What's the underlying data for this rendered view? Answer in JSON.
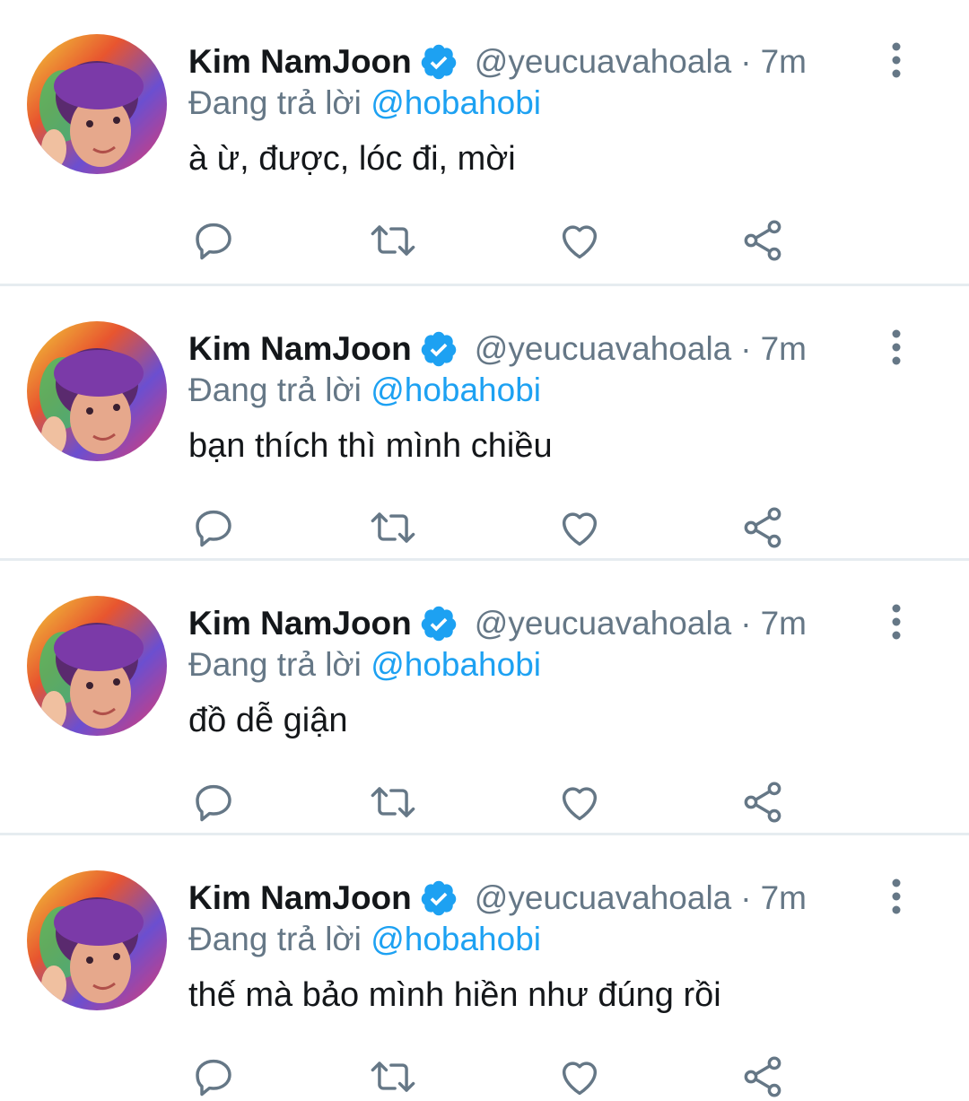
{
  "colors": {
    "name": "#14171a",
    "secondary": "#657786",
    "mention": "#1da1f2",
    "verified": "#1da1f2",
    "divider": "#e6ecf0"
  },
  "tweets": [
    {
      "name": "Kim NamJoon",
      "handle": "@yeucuavahoala",
      "separator": "·",
      "time": "7m",
      "reply_prefix": "Đang trả lời",
      "reply_to": "@hobahobi",
      "text": "à ừ, được, lóc đi, mời",
      "icons": [
        "verified-badge-icon",
        "more-vertical-icon",
        "reply-icon",
        "retweet-icon",
        "like-icon",
        "share-icon"
      ]
    },
    {
      "name": "Kim NamJoon",
      "handle": "@yeucuavahoala",
      "separator": "·",
      "time": "7m",
      "reply_prefix": "Đang trả lời",
      "reply_to": "@hobahobi",
      "text": "bạn thích thì mình chiều",
      "icons": [
        "verified-badge-icon",
        "more-vertical-icon",
        "reply-icon",
        "retweet-icon",
        "like-icon",
        "share-icon"
      ]
    },
    {
      "name": "Kim NamJoon",
      "handle": "@yeucuavahoala",
      "separator": "·",
      "time": "7m",
      "reply_prefix": "Đang trả lời",
      "reply_to": "@hobahobi",
      "text": "đồ dễ giận",
      "icons": [
        "verified-badge-icon",
        "more-vertical-icon",
        "reply-icon",
        "retweet-icon",
        "like-icon",
        "share-icon"
      ]
    },
    {
      "name": "Kim NamJoon",
      "handle": "@yeucuavahoala",
      "separator": "·",
      "time": "7m",
      "reply_prefix": "Đang trả lời",
      "reply_to": "@hobahobi",
      "text": "thế mà bảo mình hiền như đúng rồi",
      "icons": [
        "verified-badge-icon",
        "more-vertical-icon",
        "reply-icon",
        "retweet-icon",
        "like-icon",
        "share-icon"
      ]
    }
  ]
}
